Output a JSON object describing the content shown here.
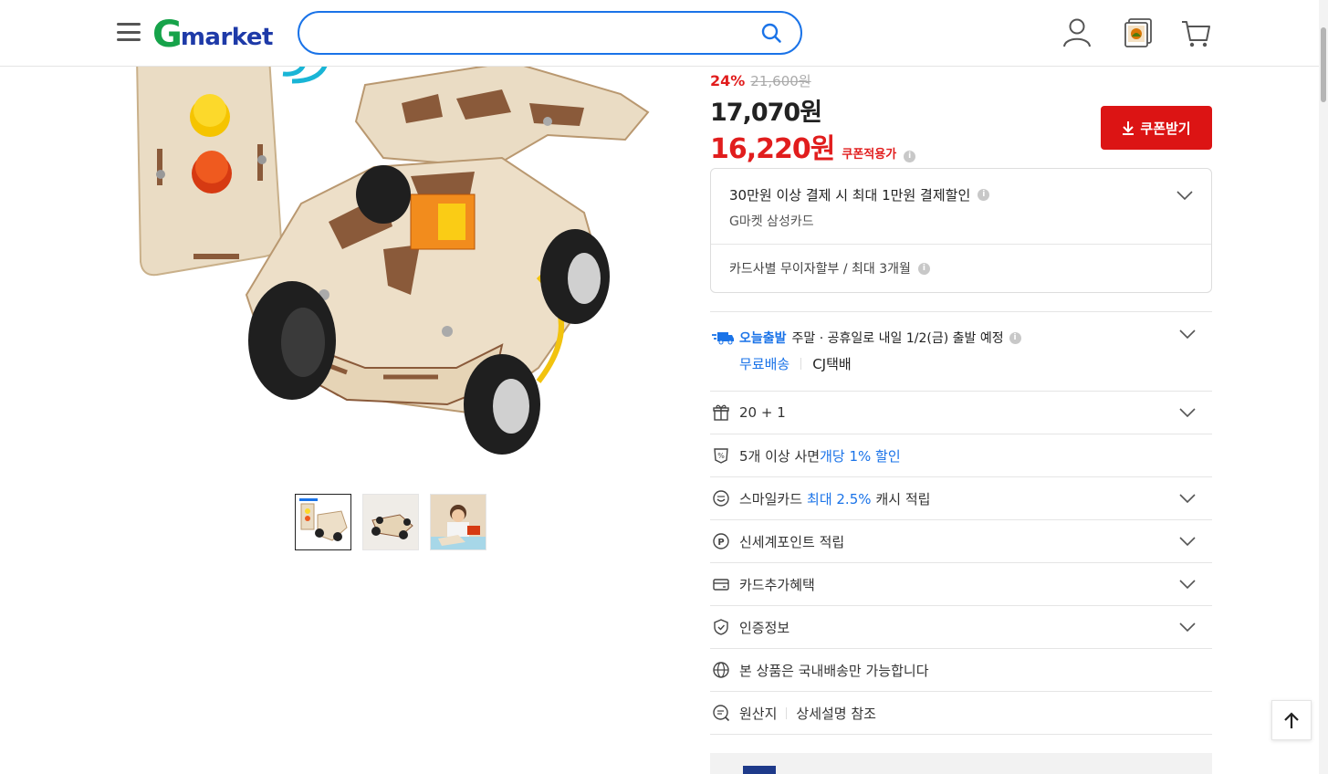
{
  "header": {
    "logo_g": "G",
    "logo_rest": "market",
    "search_placeholder": "",
    "icons": [
      "menu-icon",
      "search-icon",
      "user-icon",
      "recent-items-icon",
      "cart-icon"
    ]
  },
  "price": {
    "discount_rate": "24%",
    "original_price": "21,600원",
    "sale_price": "17,070원",
    "coupon_price": "16,220원",
    "coupon_label": "쿠폰적용가",
    "coupon_button": "쿠폰받기"
  },
  "card_promo": {
    "title": "30만원 이상 결제 시 최대 1만원 결제할인",
    "subtitle": "G마켓 삼성카드",
    "installment": "카드사별 무이자할부 / 최대 3개월"
  },
  "delivery": {
    "badge": "오늘출발",
    "text": "주말 · 공휴일로 내일 1/2(금) 출발 예정",
    "free_shipping": "무료배송",
    "carrier": "CJ택배"
  },
  "benefits": [
    {
      "icon": "gift-icon",
      "label": "20 + 1"
    },
    {
      "icon": "discount-tag-icon",
      "pre": "5개 이상 사면 ",
      "blue": "개당 1% 할인",
      "post": ""
    },
    {
      "icon": "smile-card-icon",
      "pre": "스마일카드 ",
      "blue": "최대 2.5%",
      "post": " 캐시 적립"
    },
    {
      "icon": "point-icon",
      "label": "신세계포인트 적립"
    },
    {
      "icon": "card-icon",
      "label": "카드추가혜택"
    },
    {
      "icon": "certified-shield-icon",
      "label": "인증정보"
    },
    {
      "icon": "globe-icon",
      "label": "본 상품은 국내배송만 가능합니다"
    },
    {
      "icon": "origin-search-icon",
      "pre": "원산지",
      "post": "상세설명 참조"
    }
  ],
  "colors": {
    "accent_red": "#dc1414",
    "accent_blue": "#1a73e8",
    "logo_green": "#16a34a",
    "logo_navy": "#1e3aa8"
  }
}
